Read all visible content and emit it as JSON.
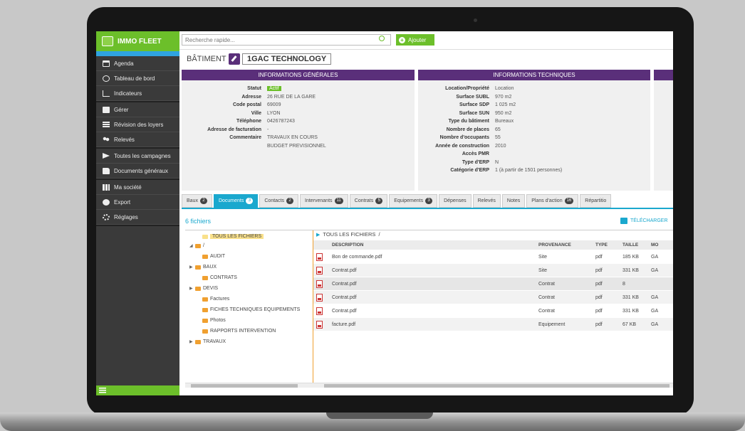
{
  "app": {
    "name": "IMMO FLEET"
  },
  "sidebar": {
    "groups": [
      [
        {
          "label": "Agenda",
          "icon": "calendar-icon"
        },
        {
          "label": "Tableau de bord",
          "icon": "dashboard-icon"
        },
        {
          "label": "Indicateurs",
          "icon": "chart-icon"
        }
      ],
      [
        {
          "label": "Gérer",
          "icon": "manage-icon"
        },
        {
          "label": "Révision des loyers",
          "icon": "table-icon"
        },
        {
          "label": "Relevés",
          "icon": "people-icon"
        }
      ],
      [
        {
          "label": "Toutes les campagnes",
          "icon": "megaphone-icon"
        },
        {
          "label": "Documents généraux",
          "icon": "folder-icon"
        }
      ],
      [
        {
          "label": "Ma société",
          "icon": "building-icon"
        },
        {
          "label": "Export",
          "icon": "export-icon"
        },
        {
          "label": "Réglages",
          "icon": "gear-icon"
        }
      ]
    ]
  },
  "topbar": {
    "search_placeholder": "Recherche rapide...",
    "add_label": "Ajouter"
  },
  "header": {
    "type_label": "BÂTIMENT",
    "name": "1GAC TECHNOLOGY"
  },
  "info_generales": {
    "title": "INFORMATIONS GÉNÉRALES",
    "rows": [
      {
        "label": "Statut",
        "value": "Actif"
      },
      {
        "label": "Adresse",
        "value": "26 RUE DE LA GARE"
      },
      {
        "label": "Code postal",
        "value": "69009"
      },
      {
        "label": "Ville",
        "value": "LYON"
      },
      {
        "label": "Téléphone",
        "value": "0426787243"
      },
      {
        "label": "Adresse de facturation",
        "value": "-"
      },
      {
        "label": "Commentaire",
        "value": "TRAVAUX EN COURS"
      },
      {
        "label": "",
        "value": "BUDGET PREVISIONNEL"
      }
    ]
  },
  "info_techniques": {
    "title": "INFORMATIONS TECHNIQUES",
    "rows": [
      {
        "label": "Location/Propriété",
        "value": "Location"
      },
      {
        "label": "Surface SUBL",
        "value": "970 m2"
      },
      {
        "label": "Surface SDP",
        "value": "1 025 m2"
      },
      {
        "label": "Surface SUN",
        "value": "950 m2"
      },
      {
        "label": "Type du bâtiment",
        "value": "Bureaux"
      },
      {
        "label": "Nombre de places",
        "value": "65"
      },
      {
        "label": "Nombre d'occupants",
        "value": "55"
      },
      {
        "label": "Année de construction",
        "value": "2010"
      },
      {
        "label": "Accès PMR",
        "value": ""
      },
      {
        "label": "Type d'ERP",
        "value": "N"
      },
      {
        "label": "Catégorie d'ERP",
        "value": "1 (à partir de 1501 personnes)"
      }
    ]
  },
  "tabs": [
    {
      "label": "Baux",
      "count": "2"
    },
    {
      "label": "Documents",
      "count": "3",
      "active": true
    },
    {
      "label": "Contacts",
      "count": "2"
    },
    {
      "label": "Intervenants",
      "count": "11"
    },
    {
      "label": "Contrats",
      "count": "5"
    },
    {
      "label": "Equipements",
      "count": "3"
    },
    {
      "label": "Dépenses",
      "count": ""
    },
    {
      "label": "Relevés",
      "count": ""
    },
    {
      "label": "Notes",
      "count": ""
    },
    {
      "label": "Plans d'action",
      "count": "16"
    },
    {
      "label": "Répartitio",
      "count": ""
    }
  ],
  "files": {
    "count_label": "6 fichiers",
    "download_label": "TÉLÉCHARGER",
    "breadcrumb": "TOUS LES FICHIERS",
    "breadcrumb_sep": "/",
    "tree": [
      {
        "label": "TOUS LES FICHIERS",
        "selected": true
      },
      {
        "label": "/"
      },
      {
        "label": "AUDIT"
      },
      {
        "label": "BAUX"
      },
      {
        "label": "CONTRATS"
      },
      {
        "label": "DEVIS"
      },
      {
        "label": "Factures"
      },
      {
        "label": "FICHES TECHNIQUES EQUIPEMENTS"
      },
      {
        "label": "Photos"
      },
      {
        "label": "RAPPORTS INTERVENTION"
      },
      {
        "label": "TRAVAUX"
      }
    ],
    "columns": [
      "DESCRIPTION",
      "PROVENANCE",
      "TYPE",
      "TAILLE",
      "MO"
    ],
    "rows": [
      {
        "description": "Bon de commande.pdf",
        "provenance": "Site",
        "type": "pdf",
        "taille": "185 KB",
        "mo": "GA"
      },
      {
        "description": "Contrat.pdf",
        "provenance": "Site",
        "type": "pdf",
        "taille": "331 KB",
        "mo": "GA"
      },
      {
        "description": "Contrat.pdf",
        "provenance": "Contrat",
        "type": "pdf",
        "taille": "8",
        "mo": ""
      },
      {
        "description": "Contrat.pdf",
        "provenance": "Contrat",
        "type": "pdf",
        "taille": "331 KB",
        "mo": "GA"
      },
      {
        "description": "Contrat.pdf",
        "provenance": "Contrat",
        "type": "pdf",
        "taille": "331 KB",
        "mo": "GA"
      },
      {
        "description": "facture.pdf",
        "provenance": "Equipement",
        "type": "pdf",
        "taille": "67 KB",
        "mo": "GA"
      }
    ]
  },
  "colors": {
    "accent_green": "#6cbf2a",
    "accent_blue": "#1aa8ce",
    "panel_purple": "#5a2f7a",
    "folder": "#f0a030"
  }
}
